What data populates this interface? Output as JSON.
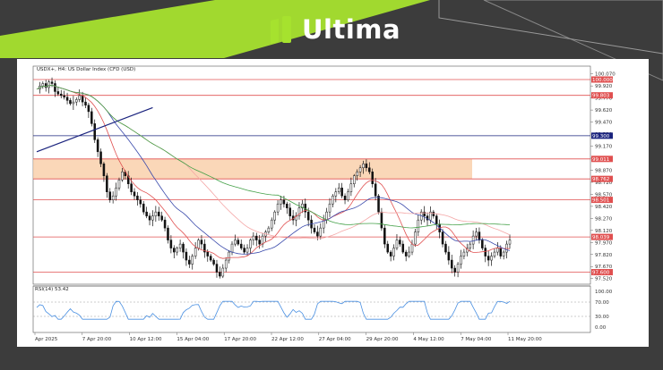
{
  "brand": {
    "name": "Ultima",
    "logo_icon": "ultima-logo-icon",
    "accent": "#a6e22e",
    "bg": "#3a3a3a"
  },
  "chart_data": {
    "type": "candlestick",
    "symbol": "USDX+, H4:",
    "instrument": "US Dollar Index (CFD (USD)",
    "title": "USDX+, H4:  US Dollar Index (CFD (USD)",
    "ylim": [
      97.45,
      100.1
    ],
    "y_ticks": [
      "100.070",
      "99.920",
      "99.770",
      "99.620",
      "99.470",
      "99.320",
      "99.170",
      "99.020",
      "98.870",
      "98.720",
      "98.570",
      "98.420",
      "98.270",
      "98.120",
      "97.970",
      "97.820",
      "97.670",
      "97.520"
    ],
    "x_ticks": [
      "Apr 2025",
      "7 Apr 20:00",
      "10 Apr 12:00",
      "15 Apr 04:00",
      "17 Apr 20:00",
      "22 Apr 12:00",
      "27 Apr 04:00",
      "29 Apr 20:00",
      "4 May 12:00",
      "7 May 04:00",
      "11 May 20:00"
    ],
    "price_levels": [
      {
        "value": 100.0,
        "label": "100.000",
        "color": "#e05050"
      },
      {
        "value": 99.803,
        "label": "99.803",
        "color": "#e05050"
      },
      {
        "value": 99.3,
        "label": "99.300",
        "color": "#1a237e"
      },
      {
        "value": 99.011,
        "label": "99.011",
        "color": "#e05050"
      },
      {
        "value": 98.762,
        "label": "98.762",
        "color": "#e05050"
      },
      {
        "value": 98.501,
        "label": "98.501",
        "color": "#e05050"
      },
      {
        "value": 98.039,
        "label": "98.039",
        "color": "#e05050"
      },
      {
        "value": 97.6,
        "label": "97.600",
        "color": "#e05050"
      }
    ],
    "zone": {
      "from": 98.762,
      "to": 99.011,
      "color": "#f8c9a0"
    },
    "trendline": {
      "from": {
        "x": "Apr 2025",
        "y": 99.1
      },
      "to": {
        "x": "17 Apr 20:00",
        "y": 99.65
      },
      "color": "#1a237e"
    },
    "close": [
      99.88,
      99.92,
      99.95,
      99.9,
      99.97,
      99.95,
      99.85,
      99.82,
      99.8,
      99.78,
      99.74,
      99.7,
      99.72,
      99.75,
      99.8,
      99.72,
      99.68,
      99.6,
      99.45,
      99.25,
      99.1,
      98.95,
      98.8,
      98.6,
      98.5,
      98.55,
      98.65,
      98.75,
      98.85,
      98.8,
      98.7,
      98.6,
      98.55,
      98.5,
      98.45,
      98.35,
      98.3,
      98.25,
      98.3,
      98.35,
      98.3,
      98.25,
      98.15,
      98.0,
      97.9,
      97.85,
      97.9,
      97.95,
      97.85,
      97.75,
      97.7,
      97.8,
      97.9,
      98.0,
      97.95,
      97.85,
      97.8,
      97.75,
      97.7,
      97.6,
      97.55,
      97.65,
      97.75,
      97.85,
      97.95,
      98.0,
      97.95,
      97.9,
      97.85,
      97.9,
      98.0,
      98.05,
      98.0,
      97.95,
      98.05,
      98.1,
      98.15,
      98.25,
      98.35,
      98.45,
      98.5,
      98.45,
      98.4,
      98.3,
      98.25,
      98.3,
      98.4,
      98.45,
      98.35,
      98.25,
      98.15,
      98.1,
      98.05,
      98.15,
      98.25,
      98.35,
      98.45,
      98.55,
      98.6,
      98.65,
      98.55,
      98.5,
      98.6,
      98.7,
      98.8,
      98.85,
      98.9,
      98.95,
      98.9,
      98.85,
      98.7,
      98.55,
      98.35,
      98.15,
      97.95,
      97.85,
      97.8,
      97.9,
      98.0,
      97.95,
      97.85,
      97.8,
      97.85,
      97.95,
      98.1,
      98.25,
      98.35,
      98.3,
      98.25,
      98.35,
      98.3,
      98.2,
      98.1,
      97.95,
      97.85,
      97.75,
      97.65,
      97.6,
      97.7,
      97.8,
      97.85,
      97.9,
      97.95,
      98.05,
      98.1,
      98.0,
      97.9,
      97.8,
      97.75,
      97.8,
      97.85,
      97.9,
      97.8,
      97.85,
      97.95,
      98.0
    ],
    "ma_series": [
      {
        "color": "#e05050",
        "period": 12
      },
      {
        "color": "#3949ab",
        "period": 24
      },
      {
        "color": "#f4a6a6",
        "period": 50
      },
      {
        "color": "#43a047",
        "period": 80
      }
    ],
    "rsi": {
      "label": "RSI(14) 53.42",
      "ylim": [
        0,
        100
      ],
      "ticks": [
        "100.00",
        "70.00",
        "30.00",
        "0.00"
      ],
      "levels": [
        70,
        30
      ],
      "color": "#4a90e2"
    }
  }
}
